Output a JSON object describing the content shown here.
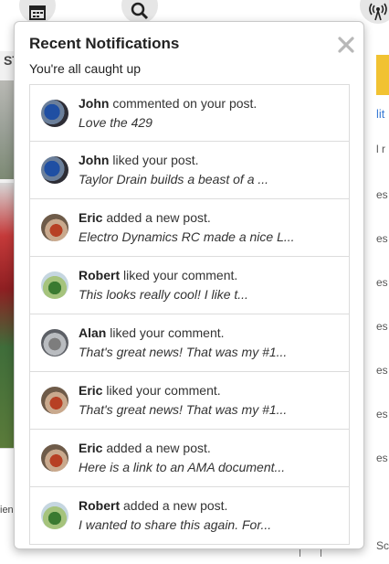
{
  "topbar": {
    "icons": [
      "calendar-icon",
      "search-icon",
      "broadcast-icon"
    ]
  },
  "background": {
    "left_label": "ST",
    "left_text": "ien",
    "right_link": "lit",
    "right_lines": [
      "l r",
      "es",
      "es",
      "es",
      "es",
      "es",
      "es",
      "es"
    ],
    "bottom_text": "Sc"
  },
  "popup": {
    "title": "Recent Notifications",
    "subtitle": "You're all caught up",
    "close_icon": "close-icon",
    "items": [
      {
        "user": "John",
        "action": "commented on your post.",
        "snippet": "Love the 429",
        "avatar": "john"
      },
      {
        "user": "John",
        "action": "liked your post.",
        "snippet": "Taylor Drain builds a beast of a ...",
        "avatar": "john"
      },
      {
        "user": "Eric",
        "action": "added a new post.",
        "snippet": "Electro Dynamics RC made a nice L...",
        "avatar": "eric"
      },
      {
        "user": "Robert",
        "action": "liked your comment.",
        "snippet": "This looks really cool! I like t...",
        "avatar": "robert"
      },
      {
        "user": "Alan",
        "action": "liked your comment.",
        "snippet": "That's great news! That was my #1...",
        "avatar": "alan"
      },
      {
        "user": "Eric",
        "action": "liked your comment.",
        "snippet": "That's great news! That was my #1...",
        "avatar": "eric"
      },
      {
        "user": "Eric",
        "action": "added a new post.",
        "snippet": "Here is a link to an AMA document...",
        "avatar": "eric"
      },
      {
        "user": "Robert",
        "action": "added a new post.",
        "snippet": "I wanted to share this again. For...",
        "avatar": "robert"
      }
    ]
  },
  "colors": {
    "accent": "#f1c232",
    "link": "#3a7bd5"
  }
}
